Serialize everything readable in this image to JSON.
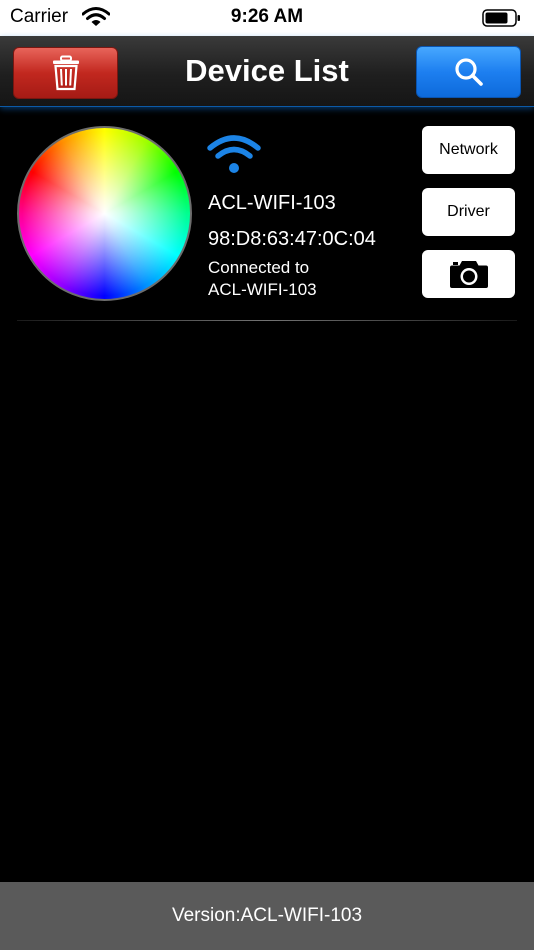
{
  "status_bar": {
    "carrier": "Carrier",
    "time": "9:26 AM"
  },
  "header": {
    "title": "Device List",
    "delete_icon": "trash-icon",
    "search_icon": "search-icon"
  },
  "device": {
    "name": "ACL-WIFI-103",
    "mac": "98:D8:63:47:0C:04",
    "connected_label": "Connected to",
    "connected_network": "ACL-WIFI-103",
    "signal_icon": "wifi-icon",
    "buttons": {
      "network": "Network",
      "driver": "Driver",
      "camera_icon": "camera-icon"
    }
  },
  "footer": {
    "version": "Version:ACL-WIFI-103"
  },
  "colors": {
    "delete_red": "#c2281f",
    "search_blue": "#1d7ff0",
    "wifi_blue": "#1c84e6",
    "footer_gray": "#5a5a5a"
  }
}
